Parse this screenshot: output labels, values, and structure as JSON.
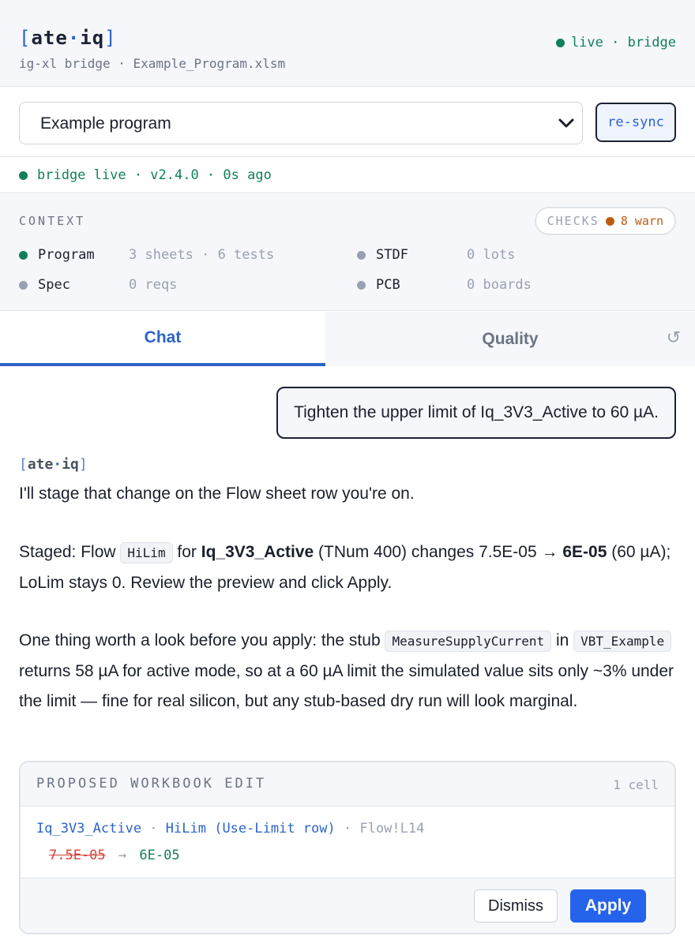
{
  "header": {
    "logo_open": "[",
    "logo_left": "ate",
    "logo_dot": "·",
    "logo_right": "iq",
    "logo_close": "]",
    "subtitle": "ig-xl bridge · Example_Program.xlsm",
    "status": "live · bridge"
  },
  "program_select": {
    "value": "Example program",
    "resync_label": "re-sync"
  },
  "bridge": {
    "status": "bridge live · v2.4.0 · 0s ago"
  },
  "context": {
    "label": "CONTEXT",
    "checks_label": "CHECKS",
    "checks_warn": "8 warn",
    "items": [
      {
        "name": "Program",
        "value": "3 sheets · 6 tests",
        "status": "active"
      },
      {
        "name": "STDF",
        "value": "0 lots",
        "status": "inactive"
      },
      {
        "name": "Spec",
        "value": "0 reqs",
        "status": "inactive"
      },
      {
        "name": "PCB",
        "value": "0 boards",
        "status": "inactive"
      }
    ]
  },
  "tabs": {
    "chat": "Chat",
    "quality": "Quality",
    "history_icon": "↺"
  },
  "chat": {
    "user_message": "Tighten the upper limit of Iq_3V3_Active to 60 µA.",
    "bot_name_left": "ate",
    "bot_name_dot": "·",
    "bot_name_right": "iq",
    "p1": "I'll stage that change on the Flow sheet row you're on.",
    "p2_a": "Staged: Flow ",
    "p2_code": "HiLim",
    "p2_b": " for ",
    "p2_bold1": "Iq_3V3_Active",
    "p2_c": " (TNum 400) changes 7.5E-05 → ",
    "p2_bold2": "6E-05",
    "p2_d": " (60 µA); LoLim stays 0. Review the preview and click Apply.",
    "p3_a": "One thing worth a look before you apply: the stub ",
    "p3_code1": "MeasureSupplyCurrent",
    "p3_b": " in ",
    "p3_code2": "VBT_Example",
    "p3_c": " returns 58 µA for active mode, so at a 60 µA limit the simulated value sits only ~3% under the limit — fine for real silicon, but any stub-based dry run will look marginal."
  },
  "edit_card": {
    "title": "PROPOSED WORKBOOK EDIT",
    "count": "1 cell",
    "test": "Iq_3V3_Active",
    "field": "HiLim (Use-Limit row)",
    "location": "Flow!L14",
    "old_value": "7.5E-05",
    "arrow": "→",
    "new_value": "6E-05",
    "dismiss_label": "Dismiss",
    "apply_label": "Apply"
  },
  "colors": {
    "accent": "#2c64c9",
    "live_green": "#11805a",
    "warn_orange": "#bd5b12",
    "apply_blue": "#2563eb"
  }
}
